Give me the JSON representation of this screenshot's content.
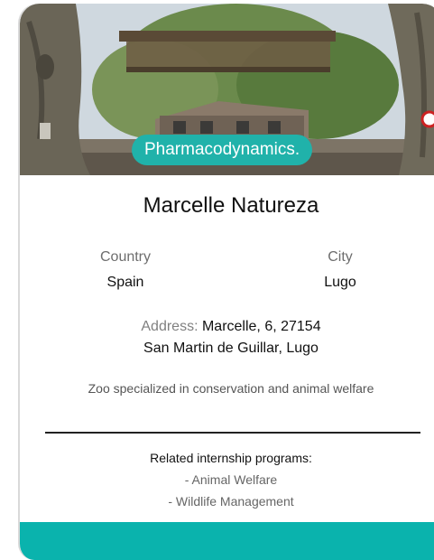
{
  "card": {
    "category_tag": "Pharmacodynamics.",
    "name": "Marcelle Natureza",
    "country_label": "Country",
    "country_value": "Spain",
    "city_label": "City",
    "city_value": "Lugo",
    "address_label": "Address:",
    "address_line1": "Marcelle, 6, 27154",
    "address_line2": "San Martin de Guillar, Lugo",
    "description": "Zoo specialized in conservation and animal welfare",
    "programs_heading": "Related internship programs:",
    "programs": [
      "- Animal Welfare",
      "- Wildlife Management"
    ]
  },
  "colors": {
    "accent": "#0ab3ad",
    "tag_bg": "#20b2aa"
  }
}
